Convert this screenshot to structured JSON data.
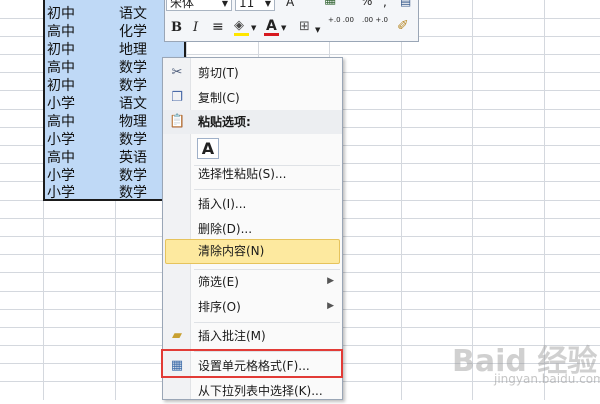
{
  "sheet": {
    "rows": [
      [
        "初中",
        "语文"
      ],
      [
        "高中",
        "化学"
      ],
      [
        "初中",
        "地理"
      ],
      [
        "高中",
        "数学"
      ],
      [
        "初中",
        "数学"
      ],
      [
        "小学",
        "语文"
      ],
      [
        "高中",
        "物理"
      ],
      [
        "小学",
        "数学"
      ],
      [
        "高中",
        "英语"
      ],
      [
        "小学",
        "数学"
      ],
      [
        "小学",
        "数学"
      ]
    ],
    "selection_color": "#bfd9f6"
  },
  "toolbar": {
    "font_name": "宋体",
    "font_size": "11",
    "bold": "B",
    "italic": "I",
    "font_color_letter": "A",
    "dec_increase": "+.0 .00",
    "dec_decrease": ".00 +.0"
  },
  "menu": {
    "cut": "剪切(T)",
    "copy": "复制(C)",
    "paste_options": "粘贴选项:",
    "paste_icon": "A",
    "paste_special": "选择性粘贴(S)...",
    "insert": "插入(I)...",
    "delete": "删除(D)...",
    "clear": "清除内容(N)",
    "filter": "筛选(E)",
    "sort": "排序(O)",
    "insert_comment": "插入批注(M)",
    "format_cells": "设置单元格格式(F)...",
    "pick_list": "从下拉列表中选择(K)..."
  },
  "colors": {
    "hover": "#fde99f",
    "highlight_box": "#e23b36",
    "font_color_bar": "#d71920",
    "fill_color_bar": "#ffe600"
  },
  "watermark": {
    "text": "Baid 经验",
    "sub": "jingyan.baidu.com"
  }
}
